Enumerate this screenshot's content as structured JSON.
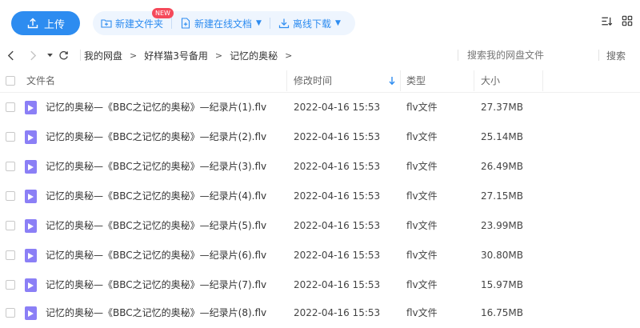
{
  "toolbar": {
    "upload_label": "上传",
    "new_folder_label": "新建文件夹",
    "new_online_doc_label": "新建在线文档",
    "new_badge": "NEW",
    "offline_download_label": "离线下载",
    "accent_color": "#2d8cf0"
  },
  "nav": {
    "breadcrumbs": [
      "我的网盘",
      "好样猫3号备用",
      "记忆的奥秘"
    ],
    "search_placeholder": "搜索我的网盘文件",
    "search_button": "搜索"
  },
  "table": {
    "columns": {
      "name": "文件名",
      "modified": "修改时间",
      "type": "类型",
      "size": "大小"
    },
    "sorted_by": "modified",
    "rows": [
      {
        "name": "记忆的奥秘—《BBC之记忆的奥秘》—纪录片(1).flv",
        "modified": "2022-04-16 15:53",
        "type": "flv文件",
        "size": "27.37MB"
      },
      {
        "name": "记忆的奥秘—《BBC之记忆的奥秘》—纪录片(2).flv",
        "modified": "2022-04-16 15:53",
        "type": "flv文件",
        "size": "25.14MB"
      },
      {
        "name": "记忆的奥秘—《BBC之记忆的奥秘》—纪录片(3).flv",
        "modified": "2022-04-16 15:53",
        "type": "flv文件",
        "size": "26.49MB"
      },
      {
        "name": "记忆的奥秘—《BBC之记忆的奥秘》—纪录片(4).flv",
        "modified": "2022-04-16 15:53",
        "type": "flv文件",
        "size": "27.15MB"
      },
      {
        "name": "记忆的奥秘—《BBC之记忆的奥秘》—纪录片(5).flv",
        "modified": "2022-04-16 15:53",
        "type": "flv文件",
        "size": "23.99MB"
      },
      {
        "name": "记忆的奥秘—《BBC之记忆的奥秘》—纪录片(6).flv",
        "modified": "2022-04-16 15:53",
        "type": "flv文件",
        "size": "30.80MB"
      },
      {
        "name": "记忆的奥秘—《BBC之记忆的奥秘》—纪录片(7).flv",
        "modified": "2022-04-16 15:53",
        "type": "flv文件",
        "size": "15.97MB"
      },
      {
        "name": "记忆的奥秘—《BBC之记忆的奥秘》—纪录片(8).flv",
        "modified": "2022-04-16 15:53",
        "type": "flv文件",
        "size": "16.75MB"
      }
    ]
  },
  "icons": {
    "upload": "upload-icon",
    "new_folder": "folder-plus-icon",
    "new_doc": "document-plus-icon",
    "download": "download-icon",
    "sort": "sort-icon",
    "grid_view": "grid-view-icon",
    "file": "video-file-icon",
    "file_color": "#8b7ff6"
  }
}
